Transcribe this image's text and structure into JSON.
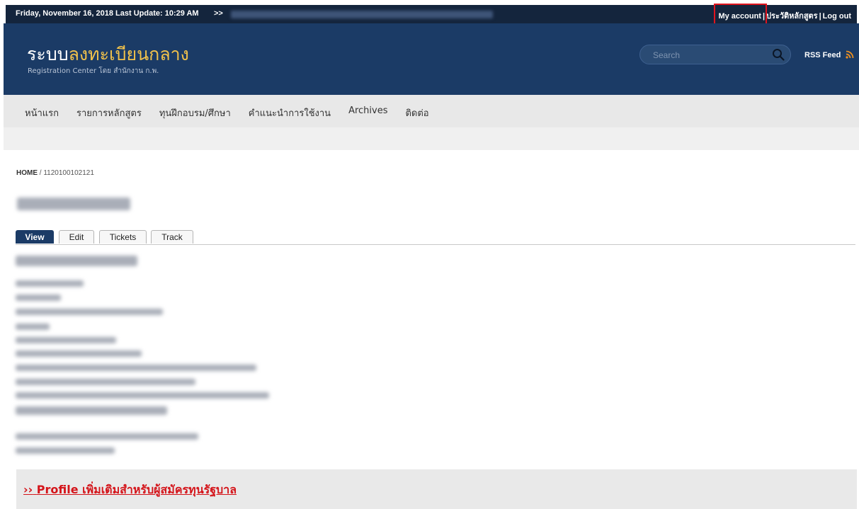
{
  "topbar": {
    "date_text": "Friday, November 16, 2018 Last Update: 10:29 AM",
    "ticker_arrow": ">>",
    "links": {
      "my_account": "My account",
      "course_history": "ประวัติหลักสูตร",
      "logout": "Log out",
      "separator": "|"
    }
  },
  "header": {
    "title_white": "ระบบ",
    "title_gold": "ลงทะเบียนกลาง",
    "subtitle": "Registration Center โดย สำนักงาน ก.พ.",
    "search": {
      "placeholder": "Search"
    },
    "rss_label": "RSS Feed"
  },
  "nav": {
    "items": [
      {
        "label": "หน้าแรก"
      },
      {
        "label": "รายการหลักสูตร"
      },
      {
        "label": "ทุนฝึกอบรม/ศึกษา"
      },
      {
        "label": "คำแนะนำการใช้งาน"
      },
      {
        "label": "Archives"
      },
      {
        "label": "ติดต่อ"
      }
    ]
  },
  "breadcrumb": {
    "home": "HOME",
    "separator": "/",
    "current": "1120100102121"
  },
  "tabs": [
    {
      "label": "View",
      "active": true
    },
    {
      "label": "Edit",
      "active": false
    },
    {
      "label": "Tickets",
      "active": false
    },
    {
      "label": "Track",
      "active": false
    }
  ],
  "profile": {
    "arrow": "››",
    "link_text": "Profile เพิ่มเติมสำหรับผู้สมัครทุนรัฐบาล"
  },
  "colors": {
    "topbar_bg": "#14253d",
    "header_bg": "#1b3b66",
    "title_accent": "#f0c14b",
    "highlight_border": "#e1141e",
    "profile_link": "#d4141a",
    "rss_orange": "#f0901e"
  }
}
